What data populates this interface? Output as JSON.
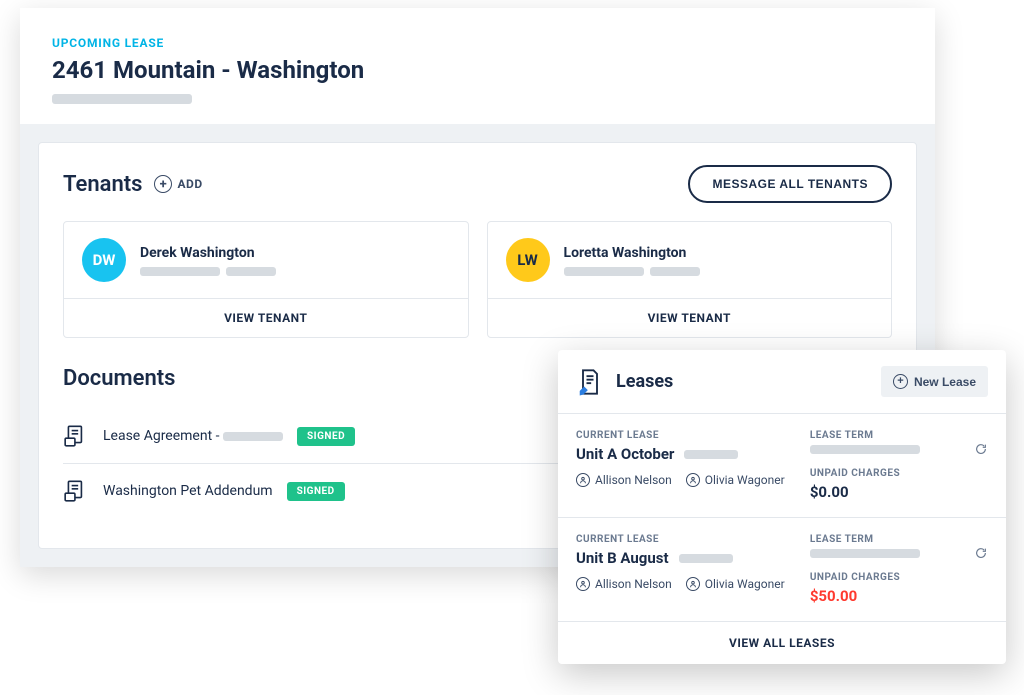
{
  "header": {
    "badge": "UPCOMING LEASE",
    "title": "2461 Mountain - Washington"
  },
  "tenants": {
    "heading": "Tenants",
    "add_label": "ADD",
    "message_all_label": "MESSAGE ALL TENANTS",
    "view_label": "VIEW TENANT",
    "list": [
      {
        "initials": "DW",
        "name": "Derek Washington",
        "avatar_class": "avatar-blue"
      },
      {
        "initials": "LW",
        "name": "Loretta Washington",
        "avatar_class": "avatar-yellow"
      }
    ]
  },
  "documents": {
    "heading": "Documents",
    "signed_label": "SIGNED",
    "items": [
      {
        "name_prefix": "Lease Agreement -",
        "has_placeholder": true
      },
      {
        "name_prefix": "Washington Pet Addendum",
        "has_placeholder": false
      }
    ]
  },
  "leases": {
    "heading": "Leases",
    "new_label": "New Lease",
    "current_label": "CURRENT LEASE",
    "term_label": "LEASE TERM",
    "unpaid_label": "UNPAID CHARGES",
    "view_all_label": "VIEW ALL LEASES",
    "items": [
      {
        "name": "Unit A October",
        "tenants": [
          "Allison Nelson",
          "Olivia Wagoner"
        ],
        "unpaid": "$0.00",
        "unpaid_red": false
      },
      {
        "name": "Unit B August",
        "tenants": [
          "Allison Nelson",
          "Olivia Wagoner"
        ],
        "unpaid": "$50.00",
        "unpaid_red": true
      }
    ]
  }
}
